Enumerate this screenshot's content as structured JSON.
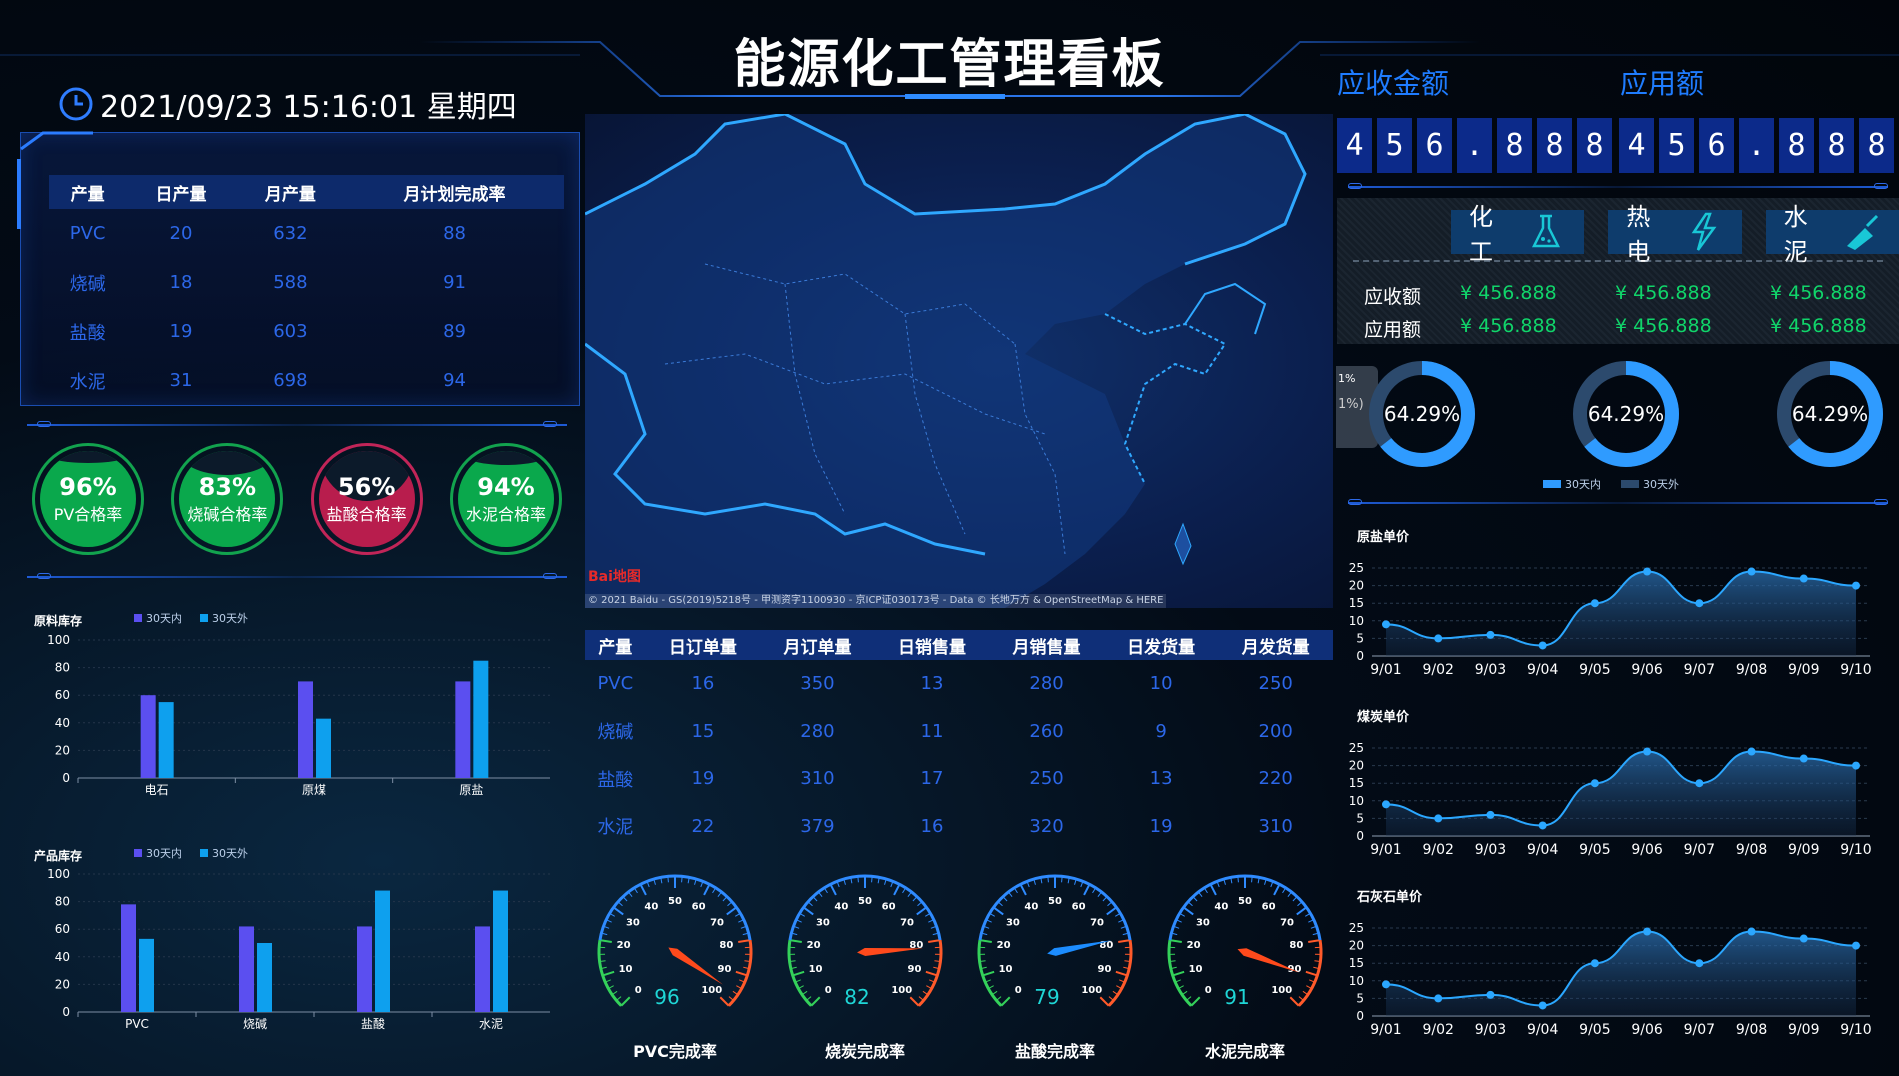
{
  "header": {
    "title": "能源化工管理看板",
    "datetime": "2021/09/23 15:16:01 星期四"
  },
  "production_table": {
    "headers": [
      "产量",
      "日产量",
      "月产量",
      "月计划完成率"
    ],
    "rows": [
      [
        "PVC",
        "20",
        "632",
        "88"
      ],
      [
        "烧碱",
        "18",
        "588",
        "91"
      ],
      [
        "盐酸",
        "19",
        "603",
        "89"
      ],
      [
        "水泥",
        "31",
        "698",
        "94"
      ]
    ]
  },
  "pass_rates": [
    {
      "pct": "96%",
      "label": "PV合格率",
      "value": 0.96,
      "color": "#0aa84c"
    },
    {
      "pct": "83%",
      "label": "烧碱合格率",
      "value": 0.83,
      "color": "#0aa84c"
    },
    {
      "pct": "56%",
      "label": "盐酸合格率",
      "value": 0.56,
      "color": "#b81d4d"
    },
    {
      "pct": "94%",
      "label": "水泥合格率",
      "value": 0.94,
      "color": "#0aa84c"
    }
  ],
  "legend": {
    "in": "30天内",
    "out": "30天外",
    "in_color": "#5b4ff0",
    "out_color": "#0ea0ee"
  },
  "chart_data": [
    {
      "type": "bar",
      "title": "原料库存",
      "categories": [
        "电石",
        "原煤",
        "原盐"
      ],
      "series": [
        {
          "name": "30天内",
          "values": [
            60,
            70,
            70
          ]
        },
        {
          "name": "30天外",
          "values": [
            55,
            43,
            85
          ]
        }
      ],
      "ylim": [
        0,
        100
      ],
      "yticks": [
        "100",
        "80",
        "60",
        "40",
        "20",
        "0"
      ]
    },
    {
      "type": "bar",
      "title": "产品库存",
      "categories": [
        "PVC",
        "烧碱",
        "盐酸",
        "水泥"
      ],
      "series": [
        {
          "name": "30天内",
          "values": [
            78,
            62,
            62,
            62
          ]
        },
        {
          "name": "30天外",
          "values": [
            53,
            50,
            88,
            88
          ]
        }
      ],
      "ylim": [
        0,
        100
      ],
      "yticks": [
        "100",
        "80",
        "60",
        "40",
        "20",
        "0"
      ]
    },
    {
      "type": "area",
      "title": "原盐单价",
      "categories": [
        "9/01",
        "9/02",
        "9/03",
        "9/04",
        "9/05",
        "9/06",
        "9/07",
        "9/08",
        "9/09",
        "9/10"
      ],
      "values": [
        9,
        5,
        6,
        3,
        15,
        24,
        15,
        24,
        22,
        20
      ],
      "ylim": [
        0,
        25
      ],
      "yticks": [
        "25",
        "20",
        "15",
        "10",
        "5",
        "0"
      ]
    },
    {
      "type": "area",
      "title": "煤炭单价",
      "categories": [
        "9/01",
        "9/02",
        "9/03",
        "9/04",
        "9/05",
        "9/06",
        "9/07",
        "9/08",
        "9/09",
        "9/10"
      ],
      "values": [
        9,
        5,
        6,
        3,
        15,
        24,
        15,
        24,
        22,
        20
      ],
      "ylim": [
        0,
        25
      ],
      "yticks": [
        "25",
        "20",
        "15",
        "10",
        "5",
        "0"
      ]
    },
    {
      "type": "area",
      "title": "石灰石单价",
      "categories": [
        "9/01",
        "9/02",
        "9/03",
        "9/04",
        "9/05",
        "9/06",
        "9/07",
        "9/08",
        "9/09",
        "9/10"
      ],
      "values": [
        9,
        5,
        6,
        3,
        15,
        24,
        15,
        24,
        22,
        20
      ],
      "ylim": [
        0,
        25
      ],
      "yticks": [
        "25",
        "20",
        "15",
        "10",
        "5",
        "0"
      ]
    }
  ],
  "map": {
    "logo": "Bai地图",
    "attribution": "© 2021 Baidu - GS(2019)5218号 - 甲测资字1100930 - 京ICP证030173号 - Data © 长地万方 & OpenStreetMap & HERE"
  },
  "sales_table": {
    "headers": [
      "产量",
      "日订单量",
      "月订单量",
      "日销售量",
      "月销售量",
      "日发货量",
      "月发货量"
    ],
    "rows": [
      [
        "PVC",
        "16",
        "350",
        "13",
        "280",
        "10",
        "250"
      ],
      [
        "烧碱",
        "15",
        "280",
        "11",
        "260",
        "9",
        "200"
      ],
      [
        "盐酸",
        "19",
        "310",
        "17",
        "250",
        "13",
        "220"
      ],
      [
        "水泥",
        "22",
        "379",
        "16",
        "320",
        "19",
        "310"
      ]
    ]
  },
  "gauges": [
    {
      "value": "96",
      "label": "PVC完成率",
      "needle_color": "#ff4a1c",
      "num": 96
    },
    {
      "value": "82",
      "label": "烧炭完成率",
      "needle_color": "#ff4a1c",
      "num": 82
    },
    {
      "value": "79",
      "label": "盐酸完成率",
      "needle_color": "#1c8cff",
      "num": 79
    },
    {
      "value": "91",
      "label": "水泥完成率",
      "needle_color": "#ff4a1c",
      "num": 91
    }
  ],
  "gauge_ticks": [
    "0",
    "10",
    "20",
    "30",
    "40",
    "50",
    "60",
    "70",
    "80",
    "90",
    "100"
  ],
  "right": {
    "receivable_label": "应收金额",
    "usage_label": "应用额",
    "receivable_digits": [
      "4",
      "5",
      "6",
      ".",
      "8",
      "8",
      "8"
    ],
    "usage_digits": [
      "4",
      "5",
      "6",
      ".",
      "8",
      "8",
      "8"
    ],
    "categories": [
      {
        "label": "化工",
        "icon": "flask-icon"
      },
      {
        "label": "热电",
        "icon": "lightning-icon"
      },
      {
        "label": "水泥",
        "icon": "trowel-icon"
      }
    ],
    "row1_label": "应收额",
    "row2_label": "应用额",
    "amounts": [
      "¥ 456.888",
      "¥ 456.888",
      "¥ 456.888"
    ],
    "donuts": [
      {
        "text": "64.29%",
        "value": 0.6429
      },
      {
        "text": "64.29%",
        "value": 0.6429
      },
      {
        "text": "64.29%",
        "value": 0.6429
      }
    ],
    "tooltip_frag1": "1%",
    "tooltip_frag2": "1%)",
    "donut_legend": [
      "30天内",
      "30天外"
    ]
  }
}
